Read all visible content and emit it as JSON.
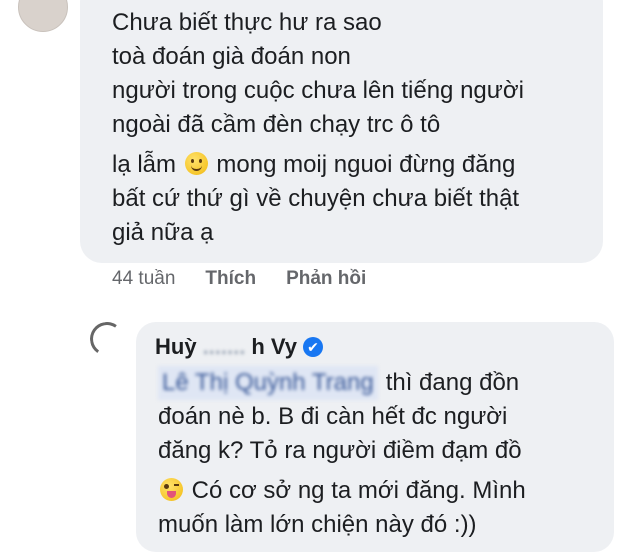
{
  "comment1": {
    "lines": [
      "Chưa biết thực hư ra sao",
      "toà đoán già đoán non",
      "người trong cuộc chưa lên tiếng  người",
      "ngoài đã cầm đèn chạy trc ô tô"
    ],
    "line5_before": "lạ lẫm",
    "line5_after": "mong moij nguoi đừng đăng",
    "lines_after": [
      "bất cứ thứ gì về chuyện chưa biết thật",
      "giả nữa ạ"
    ],
    "emoji": "slightly-smiling-face"
  },
  "meta": {
    "time": "44 tuần",
    "like": "Thích",
    "reply": "Phản hồi"
  },
  "reply": {
    "name_start": "Huỳ",
    "name_hidden": ".......",
    "name_end": "h Vy",
    "verified_icon": "✔",
    "mention": "Lê Thị Quỳnh Trang",
    "line1_after": "thì đang đồn",
    "lines": [
      "đoán nè b. B đi càn hết đc người",
      "đăng k? Tỏ ra người điềm đạm đồ"
    ],
    "line4_after": "Có cơ sở ng ta mới đăng. Mình",
    "line5": "muốn làm lớn chiện này đó :))",
    "emoji": "winking-face-with-tongue",
    "accent": "#1877f2"
  }
}
